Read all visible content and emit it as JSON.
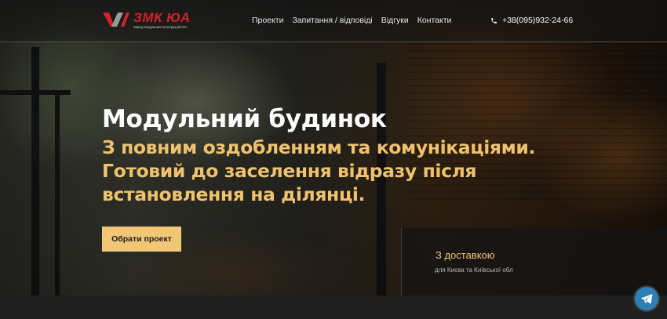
{
  "header": {
    "logo": {
      "text": "ЗМК ЮА",
      "subtitle": "Завод Модульних Конструкцій ЮА"
    },
    "nav": [
      {
        "label": "Проекти"
      },
      {
        "label": "Запитання / відповіді"
      },
      {
        "label": "Відгуки"
      },
      {
        "label": "Контакти"
      }
    ],
    "phone": "+38(095)932-24-66"
  },
  "hero": {
    "title": "Модульний будинок",
    "subtitle": "З повним оздобленням та комунікаціями. Готовий до заселення відразу після встановлення на ділянці.",
    "cta_label": "Обрати проект"
  },
  "delivery": {
    "title": "З доставкою",
    "subtitle": "для Києва та Київської обл"
  },
  "colors": {
    "accent": "#f1c677",
    "brand_red": "#d42228",
    "telegram": "#2d7fb8"
  },
  "icons": [
    "phone-icon",
    "telegram-icon",
    "logo-mark-icon"
  ]
}
